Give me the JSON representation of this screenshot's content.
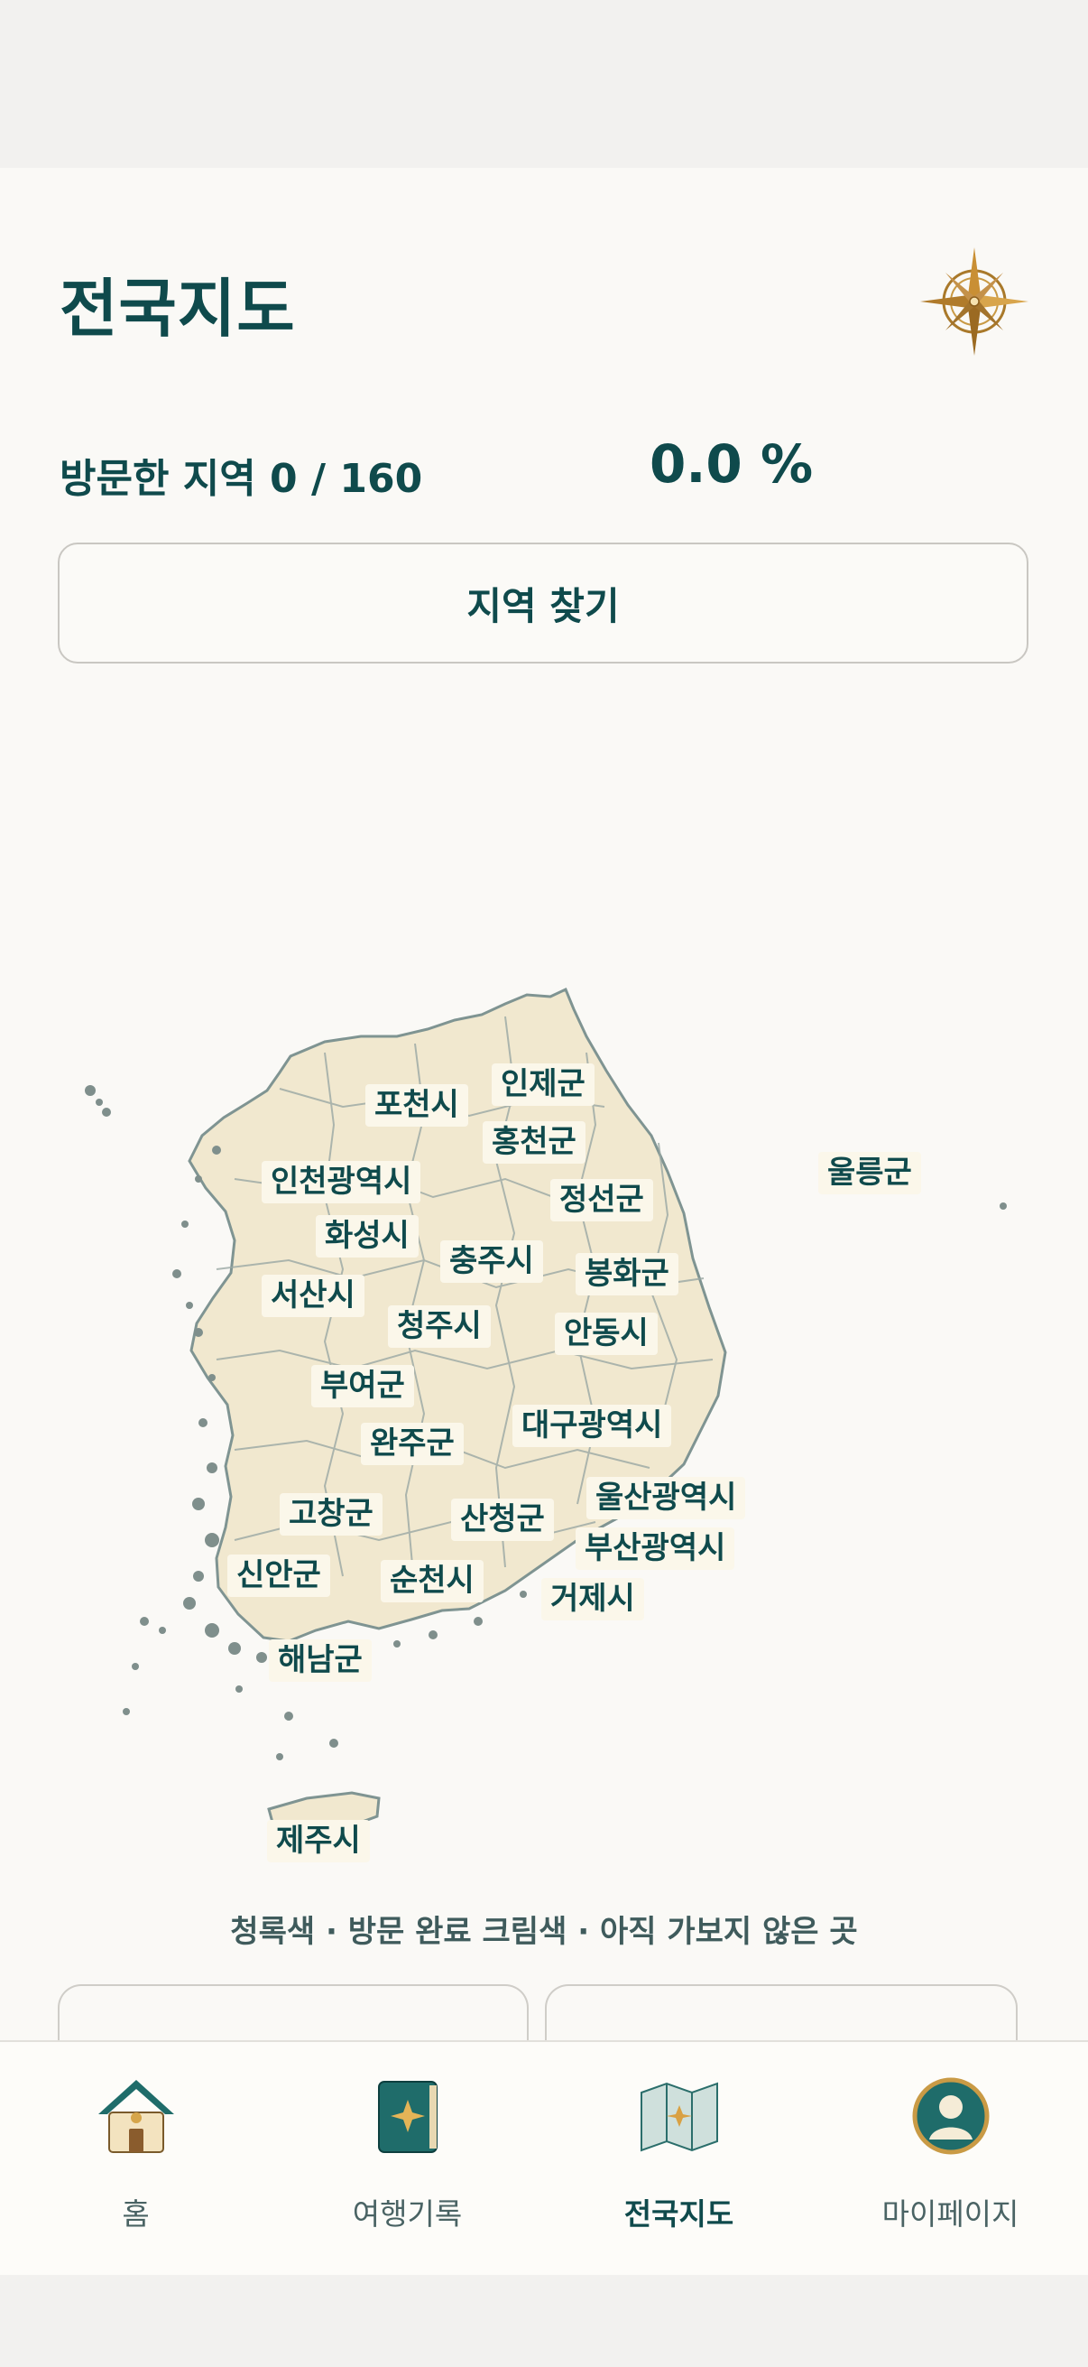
{
  "header": {
    "title": "전국지도",
    "visited_label": "방문한 지역 0 / 160",
    "percent": "0.0 %"
  },
  "find_region_button": "지역 찾기",
  "map": {
    "regions": [
      {
        "name": "포천시"
      },
      {
        "name": "인제군"
      },
      {
        "name": "홍천군"
      },
      {
        "name": "울릉군"
      },
      {
        "name": "인천광역시"
      },
      {
        "name": "정선군"
      },
      {
        "name": "화성시"
      },
      {
        "name": "충주시"
      },
      {
        "name": "봉화군"
      },
      {
        "name": "서산시"
      },
      {
        "name": "청주시"
      },
      {
        "name": "안동시"
      },
      {
        "name": "부여군"
      },
      {
        "name": "대구광역시"
      },
      {
        "name": "완주군"
      },
      {
        "name": "울산광역시"
      },
      {
        "name": "고창군"
      },
      {
        "name": "산청군"
      },
      {
        "name": "부산광역시"
      },
      {
        "name": "신안군"
      },
      {
        "name": "순천시"
      },
      {
        "name": "거제시"
      },
      {
        "name": "해남군"
      },
      {
        "name": "제주시"
      }
    ],
    "colors": {
      "land": "#f1e8cf",
      "border": "#7f9492",
      "island": "#7f8f8c"
    }
  },
  "legend": "청록색 · 방문 완료 크림색 · 아직 가보지 않은 곳",
  "tabs": [
    {
      "label": "홈",
      "icon": "home-icon"
    },
    {
      "label": "여행기록",
      "icon": "journal-icon"
    },
    {
      "label": "전국지도",
      "icon": "map-icon",
      "active": true
    },
    {
      "label": "마이페이지",
      "icon": "profile-icon"
    }
  ],
  "colors": {
    "accent": "#0f4a4c",
    "gold": "#b5862f"
  }
}
